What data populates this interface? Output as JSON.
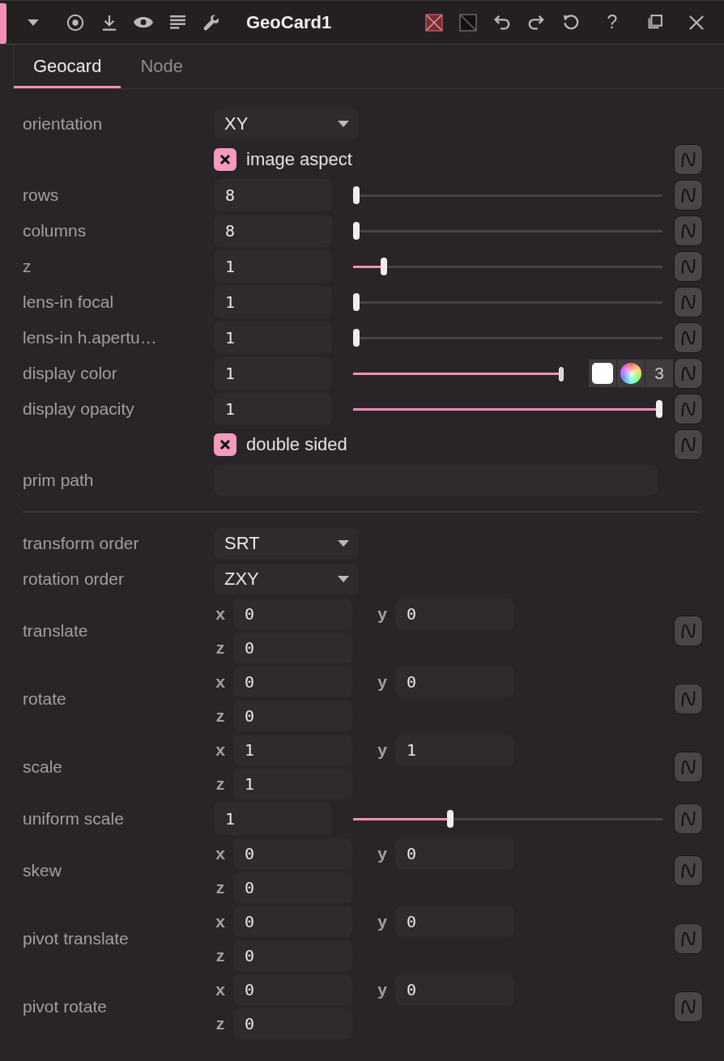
{
  "header": {
    "title": "GeoCard1",
    "help": "?"
  },
  "tabs": [
    {
      "label": "Geocard",
      "selected": true
    },
    {
      "label": "Node",
      "selected": false
    }
  ],
  "sections": [
    {
      "params": [
        {
          "kind": "dropdown",
          "label": "orientation",
          "value": "XY",
          "graph": false
        },
        {
          "kind": "checkbox",
          "label": "image aspect",
          "checked": true,
          "graph": true
        },
        {
          "kind": "slider",
          "label": "rows",
          "value": "8",
          "level": 0,
          "graph": true
        },
        {
          "kind": "slider",
          "label": "columns",
          "value": "8",
          "level": 0,
          "graph": true
        },
        {
          "kind": "slider",
          "label": "z",
          "value": "1",
          "level": 0.09,
          "graph": true
        },
        {
          "kind": "slider",
          "label": "lens-in focal",
          "value": "1",
          "level": 0,
          "graph": true
        },
        {
          "kind": "slider",
          "label": "lens-in h.apertu…",
          "value": "1",
          "level": 0,
          "graph": true
        },
        {
          "kind": "color",
          "label": "display color",
          "value": "1",
          "level": 1,
          "color": "#ffffff",
          "count": "3",
          "graph": true
        },
        {
          "kind": "slider",
          "label": "display opacity",
          "value": "1",
          "level": 1,
          "graph": true
        },
        {
          "kind": "checkbox",
          "label": "double sided",
          "checked": true,
          "graph": true
        },
        {
          "kind": "text",
          "label": "prim path",
          "graph": false
        }
      ]
    },
    {
      "params": [
        {
          "kind": "dropdown",
          "label": "transform order",
          "value": "SRT",
          "graph": false
        },
        {
          "kind": "dropdown",
          "label": "rotation order",
          "value": "ZXY",
          "graph": false
        },
        {
          "kind": "vector",
          "label": "translate",
          "components": [
            {
              "axis": "x",
              "value": "0"
            },
            {
              "axis": "y",
              "value": "0"
            },
            {
              "axis": "z",
              "value": "0"
            }
          ],
          "graph": true
        },
        {
          "kind": "vector",
          "label": "rotate",
          "components": [
            {
              "axis": "x",
              "value": "0"
            },
            {
              "axis": "y",
              "value": "0"
            },
            {
              "axis": "z",
              "value": "0"
            }
          ],
          "graph": true
        },
        {
          "kind": "vector",
          "label": "scale",
          "components": [
            {
              "axis": "x",
              "value": "1"
            },
            {
              "axis": "y",
              "value": "1"
            },
            {
              "axis": "z",
              "value": "1"
            }
          ],
          "graph": true
        },
        {
          "kind": "slider",
          "label": "uniform scale",
          "value": "1",
          "level": 0.31,
          "graph": true
        },
        {
          "kind": "vector",
          "label": "skew",
          "components": [
            {
              "axis": "x",
              "value": "0"
            },
            {
              "axis": "y",
              "value": "0"
            },
            {
              "axis": "z",
              "value": "0"
            }
          ],
          "graph": true
        },
        {
          "kind": "vector",
          "label": "pivot translate",
          "components": [
            {
              "axis": "x",
              "value": "0"
            },
            {
              "axis": "y",
              "value": "0"
            },
            {
              "axis": "z",
              "value": "0"
            }
          ],
          "graph": true
        },
        {
          "kind": "vector",
          "label": "pivot rotate",
          "components": [
            {
              "axis": "x",
              "value": "0"
            },
            {
              "axis": "y",
              "value": "0"
            },
            {
              "axis": "z",
              "value": "0"
            }
          ],
          "graph": true
        }
      ]
    }
  ]
}
